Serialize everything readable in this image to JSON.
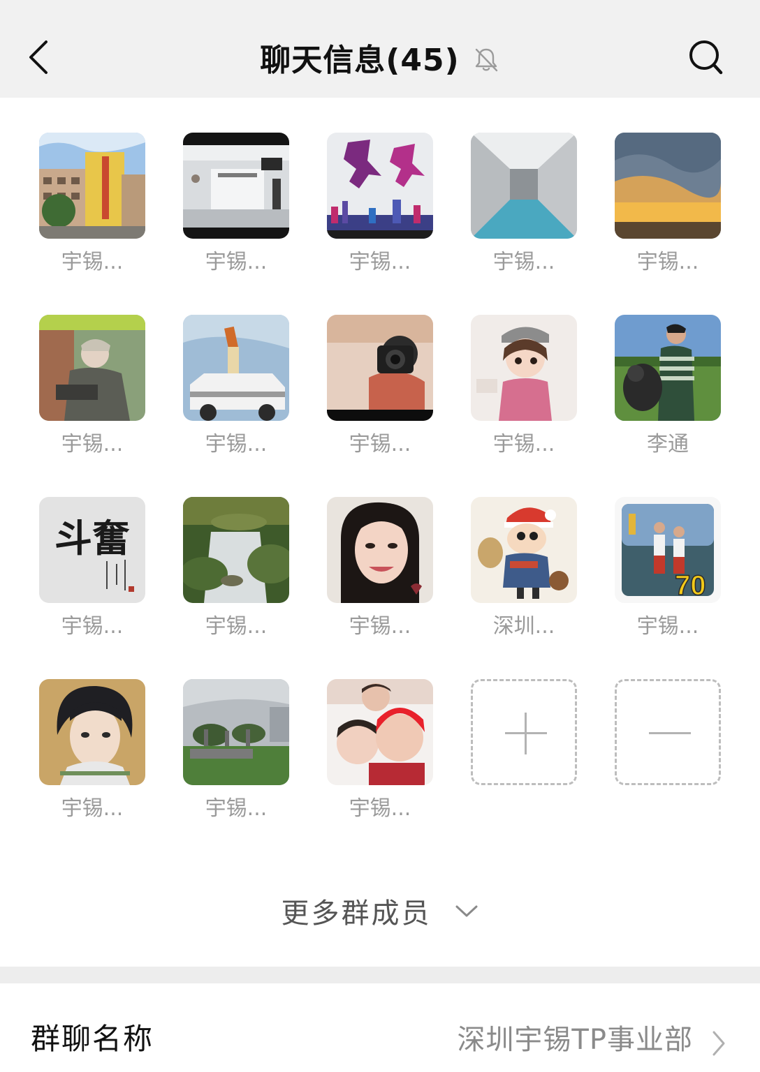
{
  "header": {
    "title": "聊天信息(45)",
    "back_icon": "chevron-left-icon",
    "mute_icon": "bell-off-icon",
    "search_icon": "search-icon"
  },
  "members": [
    {
      "name": "宇锡...",
      "avatar": "photo-building"
    },
    {
      "name": "宇锡...",
      "avatar": "photo-office-lobby"
    },
    {
      "name": "宇锡...",
      "avatar": "graphic-runners"
    },
    {
      "name": "宇锡...",
      "avatar": "photo-corridor"
    },
    {
      "name": "宇锡...",
      "avatar": "photo-sunset-sky"
    },
    {
      "name": "宇锡...",
      "avatar": "illustration-manga-man"
    },
    {
      "name": "宇锡...",
      "avatar": "photo-jeep-handstand"
    },
    {
      "name": "宇锡...",
      "avatar": "photo-camera-selfie"
    },
    {
      "name": "宇锡...",
      "avatar": "illustration-girl-cap"
    },
    {
      "name": "李通",
      "avatar": "photo-man-with-dog"
    },
    {
      "name": "宇锡...",
      "avatar": "calligraphy-fendou"
    },
    {
      "name": "宇锡...",
      "avatar": "photo-waterfall"
    },
    {
      "name": "宇锡...",
      "avatar": "photo-woman-smiling"
    },
    {
      "name": "深圳...",
      "avatar": "cartoon-crayon-shin"
    },
    {
      "name": "宇锡...",
      "avatar": "photo-kids-70"
    },
    {
      "name": "宇锡...",
      "avatar": "anime-boy"
    },
    {
      "name": "宇锡...",
      "avatar": "photo-park-gate"
    },
    {
      "name": "宇锡...",
      "avatar": "photo-family-kids"
    }
  ],
  "add_member_icon": "plus-icon",
  "remove_member_icon": "minus-icon",
  "avatar_calligraphy_text": "斗奮",
  "avatar_badge_text": "70",
  "more_members": {
    "label": "更多群成员",
    "icon": "chevron-down-icon"
  },
  "group_name_row": {
    "label": "群聊名称",
    "value": "深圳宇锡TP事业部",
    "icon": "chevron-right-icon"
  },
  "colors": {
    "header_bg": "#f1f1f1",
    "member_name": "#9a9a9a",
    "divider": "#ededed"
  }
}
